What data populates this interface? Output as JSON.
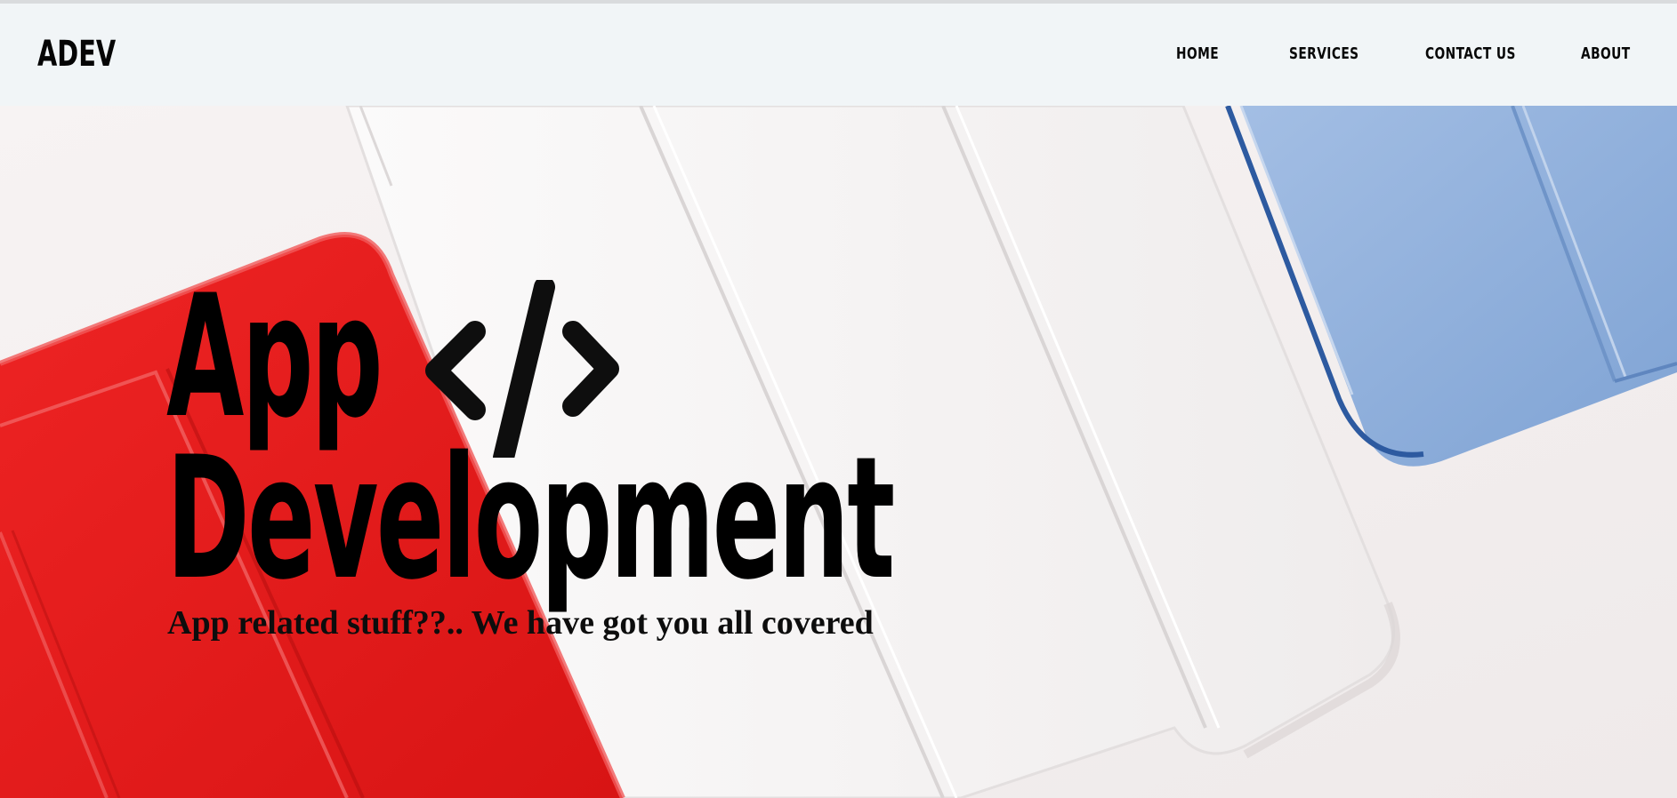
{
  "brand": "ADEV",
  "nav": {
    "home": "HOME",
    "services": "SERVICES",
    "contact": "CONTACT US",
    "about": "ABOUT"
  },
  "hero": {
    "title_line1": "App",
    "title_line2": "Development",
    "tagline": "App related stuff??.. We have got you all covered",
    "icon": "code-brackets-icon"
  },
  "colors": {
    "nav_bg": "#f1f5f7",
    "red_cover": "#e81e1e",
    "white_cover": "#f4f2f2",
    "blue_cover": "#8fb0dc",
    "text": "#000000"
  }
}
